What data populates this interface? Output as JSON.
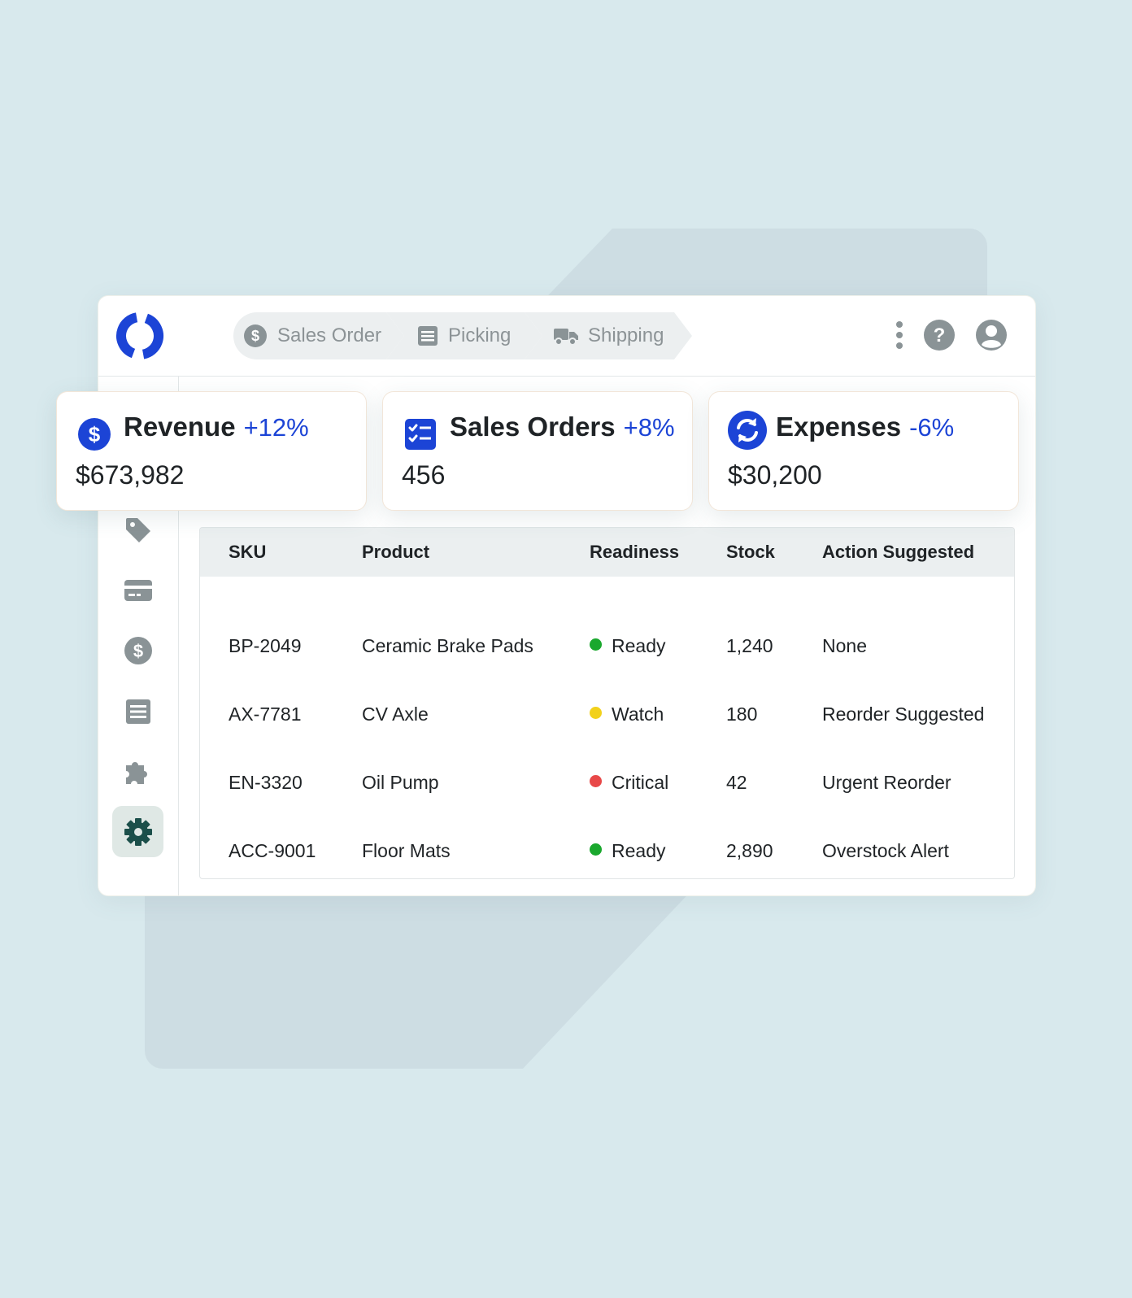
{
  "colors": {
    "brand_blue": "#1c44d6",
    "icon_gray": "#8a9396",
    "ready": "#1aa82e",
    "watch": "#f2d11b",
    "critical": "#e84848",
    "active_nav_bg": "#dfe8e5",
    "active_nav_icon": "#1b4f4a"
  },
  "header": {
    "steps": [
      {
        "label": "Sales Order",
        "icon": "dollar-circle-icon"
      },
      {
        "label": "Picking",
        "icon": "list-doc-icon"
      },
      {
        "label": "Shipping",
        "icon": "truck-icon"
      }
    ],
    "actions": [
      "more-vertical-icon",
      "help-icon",
      "user-avatar-icon"
    ]
  },
  "sidebar": {
    "items": [
      "tag-icon",
      "credit-card-icon",
      "dollar-circle-icon",
      "document-icon",
      "puzzle-icon",
      "gear-icon"
    ],
    "active": "gear-icon"
  },
  "cards": [
    {
      "label": "Revenue",
      "change": "+12%",
      "value": "$673,982",
      "icon": "dollar-circle-icon"
    },
    {
      "label": "Sales Orders",
      "change": "+8%",
      "value": "456",
      "icon": "checklist-icon"
    },
    {
      "label": "Expenses",
      "change": "-6%",
      "value": "$30,200",
      "icon": "refresh-icon"
    }
  ],
  "table": {
    "columns": [
      "SKU",
      "Product",
      "Readiness",
      "Stock",
      "Action Suggested"
    ],
    "rows": [
      {
        "sku": "BP-2049",
        "product": "Ceramic Brake Pads",
        "readiness": "Ready",
        "status": "ready",
        "stock": "1,240",
        "action": "None"
      },
      {
        "sku": "AX-7781",
        "product": "CV Axle",
        "readiness": "Watch",
        "status": "watch",
        "stock": "180",
        "action": "Reorder Suggested"
      },
      {
        "sku": "EN-3320",
        "product": "Oil Pump",
        "readiness": "Critical",
        "status": "critical",
        "stock": "42",
        "action": "Urgent Reorder"
      },
      {
        "sku": "ACC-9001",
        "product": "Floor Mats",
        "readiness": "Ready",
        "status": "ready",
        "stock": "2,890",
        "action": "Overstock Alert"
      }
    ]
  }
}
